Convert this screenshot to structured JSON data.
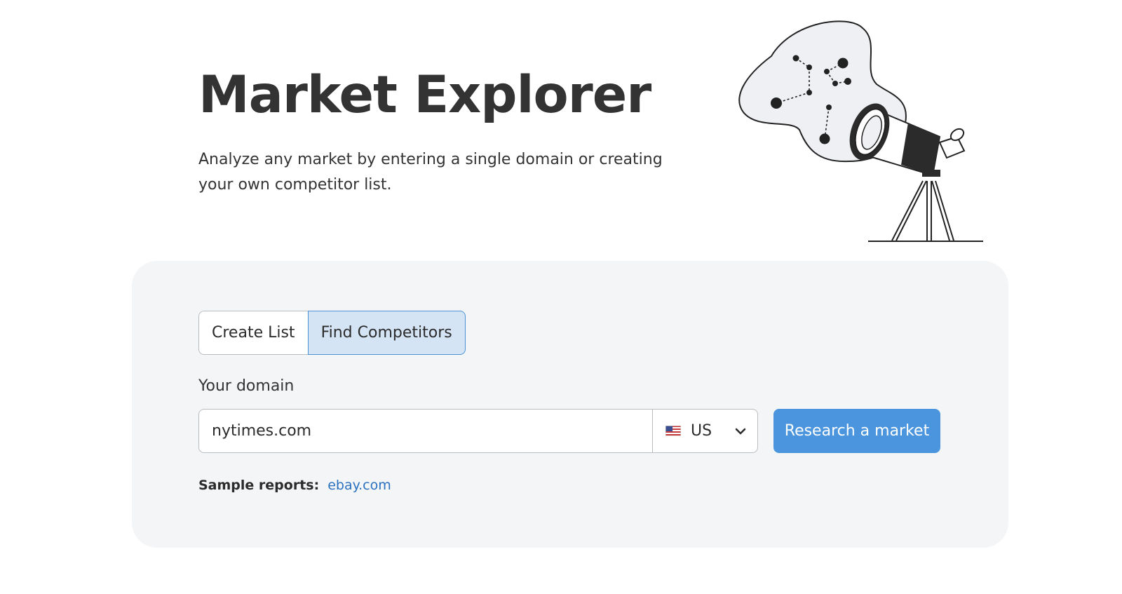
{
  "hero": {
    "title": "Market Explorer",
    "description": "Analyze any market by entering a single domain or creating your own competitor list."
  },
  "mode_toggle": {
    "options": [
      "Create List",
      "Find Competitors"
    ],
    "selected": "Find Competitors"
  },
  "domain_form": {
    "label": "Your domain",
    "value": "nytimes.com",
    "country": {
      "code": "US",
      "flag_icon": "us-flag-icon"
    },
    "submit_label": "Research a market"
  },
  "samples": {
    "label": "Sample reports:",
    "link": "ebay.com"
  },
  "colors": {
    "accent": "#4a95dd",
    "selected_tab_bg": "#d4e4f5",
    "selected_tab_border": "#4c94d6",
    "panel_bg": "#f4f5f7",
    "link": "#2a72c0"
  },
  "icons": [
    "telescope-illustration",
    "us-flag-icon",
    "chevron-down-icon"
  ]
}
